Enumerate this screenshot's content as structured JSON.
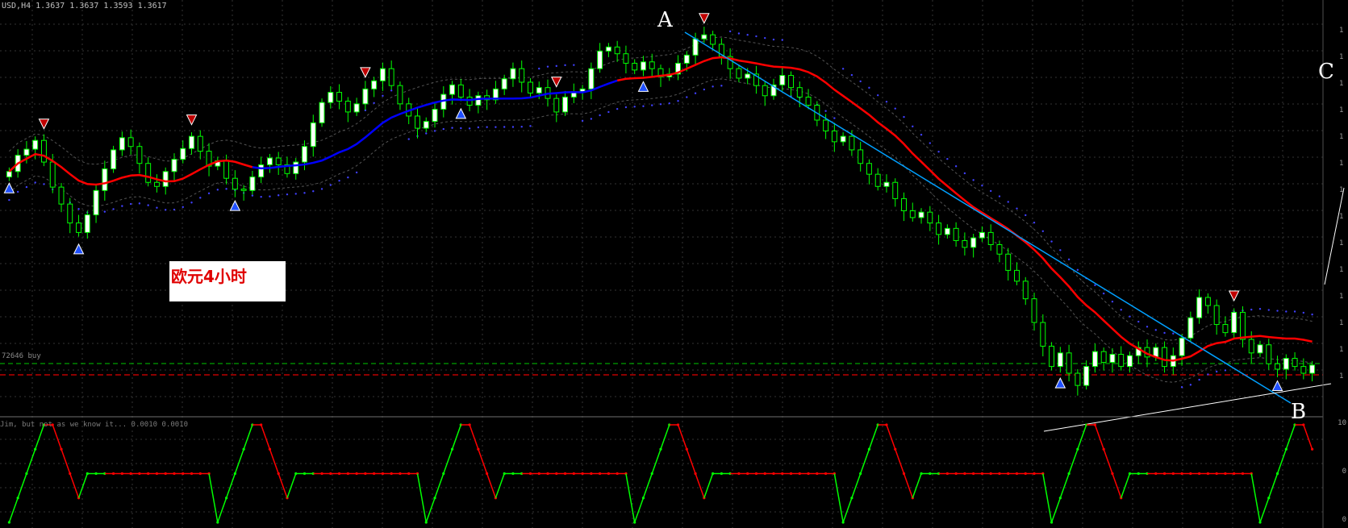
{
  "symbol_header": "USD,H4  1.3637  1.3637  1.3593  1.3617",
  "caption": "欧元4小时",
  "points": {
    "a": "A",
    "b": "B",
    "c": "C"
  },
  "buy_level_label": "72646 buy",
  "indicator_title": "Jim, but not as we know it... 0.0010 0.0010",
  "right_axis": {
    "main": [
      "1",
      "1",
      "1",
      "1",
      "1",
      "1",
      "1",
      "1",
      "1",
      "1",
      "1",
      "1",
      "1",
      "1"
    ],
    "ind_top": "10",
    "ind_mid": "0",
    "ind_bot": "0"
  },
  "colors": {
    "bull": "#ffffff",
    "bear": "#000000",
    "wick": "#00ff00",
    "ma_up": "#0000ff",
    "ma_down": "#ff0000",
    "psar": "#4040ff",
    "trend_a": "#00a0ff",
    "green_dash": "#00a000",
    "red_dash": "#e00000"
  },
  "chart_data": {
    "type": "candlestick",
    "timeframe": "H4",
    "close": [
      1.3588,
      1.3612,
      1.3621,
      1.3634,
      1.3602,
      1.3565,
      1.354,
      1.3512,
      1.3498,
      1.3524,
      1.356,
      1.3592,
      1.362,
      1.3638,
      1.3625,
      1.36,
      1.3572,
      1.3566,
      1.3588,
      1.3606,
      1.3622,
      1.364,
      1.3618,
      1.3596,
      1.3604,
      1.3578,
      1.3562,
      1.356,
      1.358,
      1.3598,
      1.3608,
      1.3598,
      1.3585,
      1.3602,
      1.3625,
      1.366,
      1.369,
      1.3705,
      1.3692,
      1.3676,
      1.3688,
      1.371,
      1.3722,
      1.374,
      1.3715,
      1.3688,
      1.367,
      1.3652,
      1.3662,
      1.368,
      1.3702,
      1.3716,
      1.3698,
      1.3686,
      1.37,
      1.3694,
      1.371,
      1.3725,
      1.374,
      1.372,
      1.3704,
      1.3712,
      1.3696,
      1.3676,
      1.3698,
      1.3706,
      1.371,
      1.374,
      1.3766,
      1.3772,
      1.3762,
      1.3748,
      1.3738,
      1.375,
      1.374,
      1.3728,
      1.3732,
      1.3748,
      1.376,
      1.3784,
      1.379,
      1.3776,
      1.3758,
      1.374,
      1.3726,
      1.3732,
      1.3715,
      1.37,
      1.3716,
      1.373,
      1.3712,
      1.3698,
      1.3686,
      1.3664,
      1.3648,
      1.3632,
      1.364,
      1.362,
      1.36,
      1.3584,
      1.3566,
      1.3572,
      1.3548,
      1.353,
      1.352,
      1.3528,
      1.3512,
      1.3495,
      1.3504,
      1.3486,
      1.3476,
      1.349,
      1.3498,
      1.348,
      1.3466,
      1.3442,
      1.3426,
      1.34,
      1.3365,
      1.333,
      1.33,
      1.332,
      1.329,
      1.3272,
      1.33,
      1.3322,
      1.3306,
      1.3318,
      1.33,
      1.3316,
      1.3328,
      1.3314,
      1.3328,
      1.33,
      1.3316,
      1.3342,
      1.3372,
      1.3402,
      1.339,
      1.3362,
      1.335,
      1.338,
      1.334,
      1.332,
      1.3332,
      1.3304,
      1.3296,
      1.3312,
      1.33,
      1.329,
      1.3302
    ],
    "open_offset_note": "",
    "ma_switch_index": 70,
    "subwindow": {
      "type": "oscillator",
      "range": [
        0,
        100
      ]
    }
  }
}
